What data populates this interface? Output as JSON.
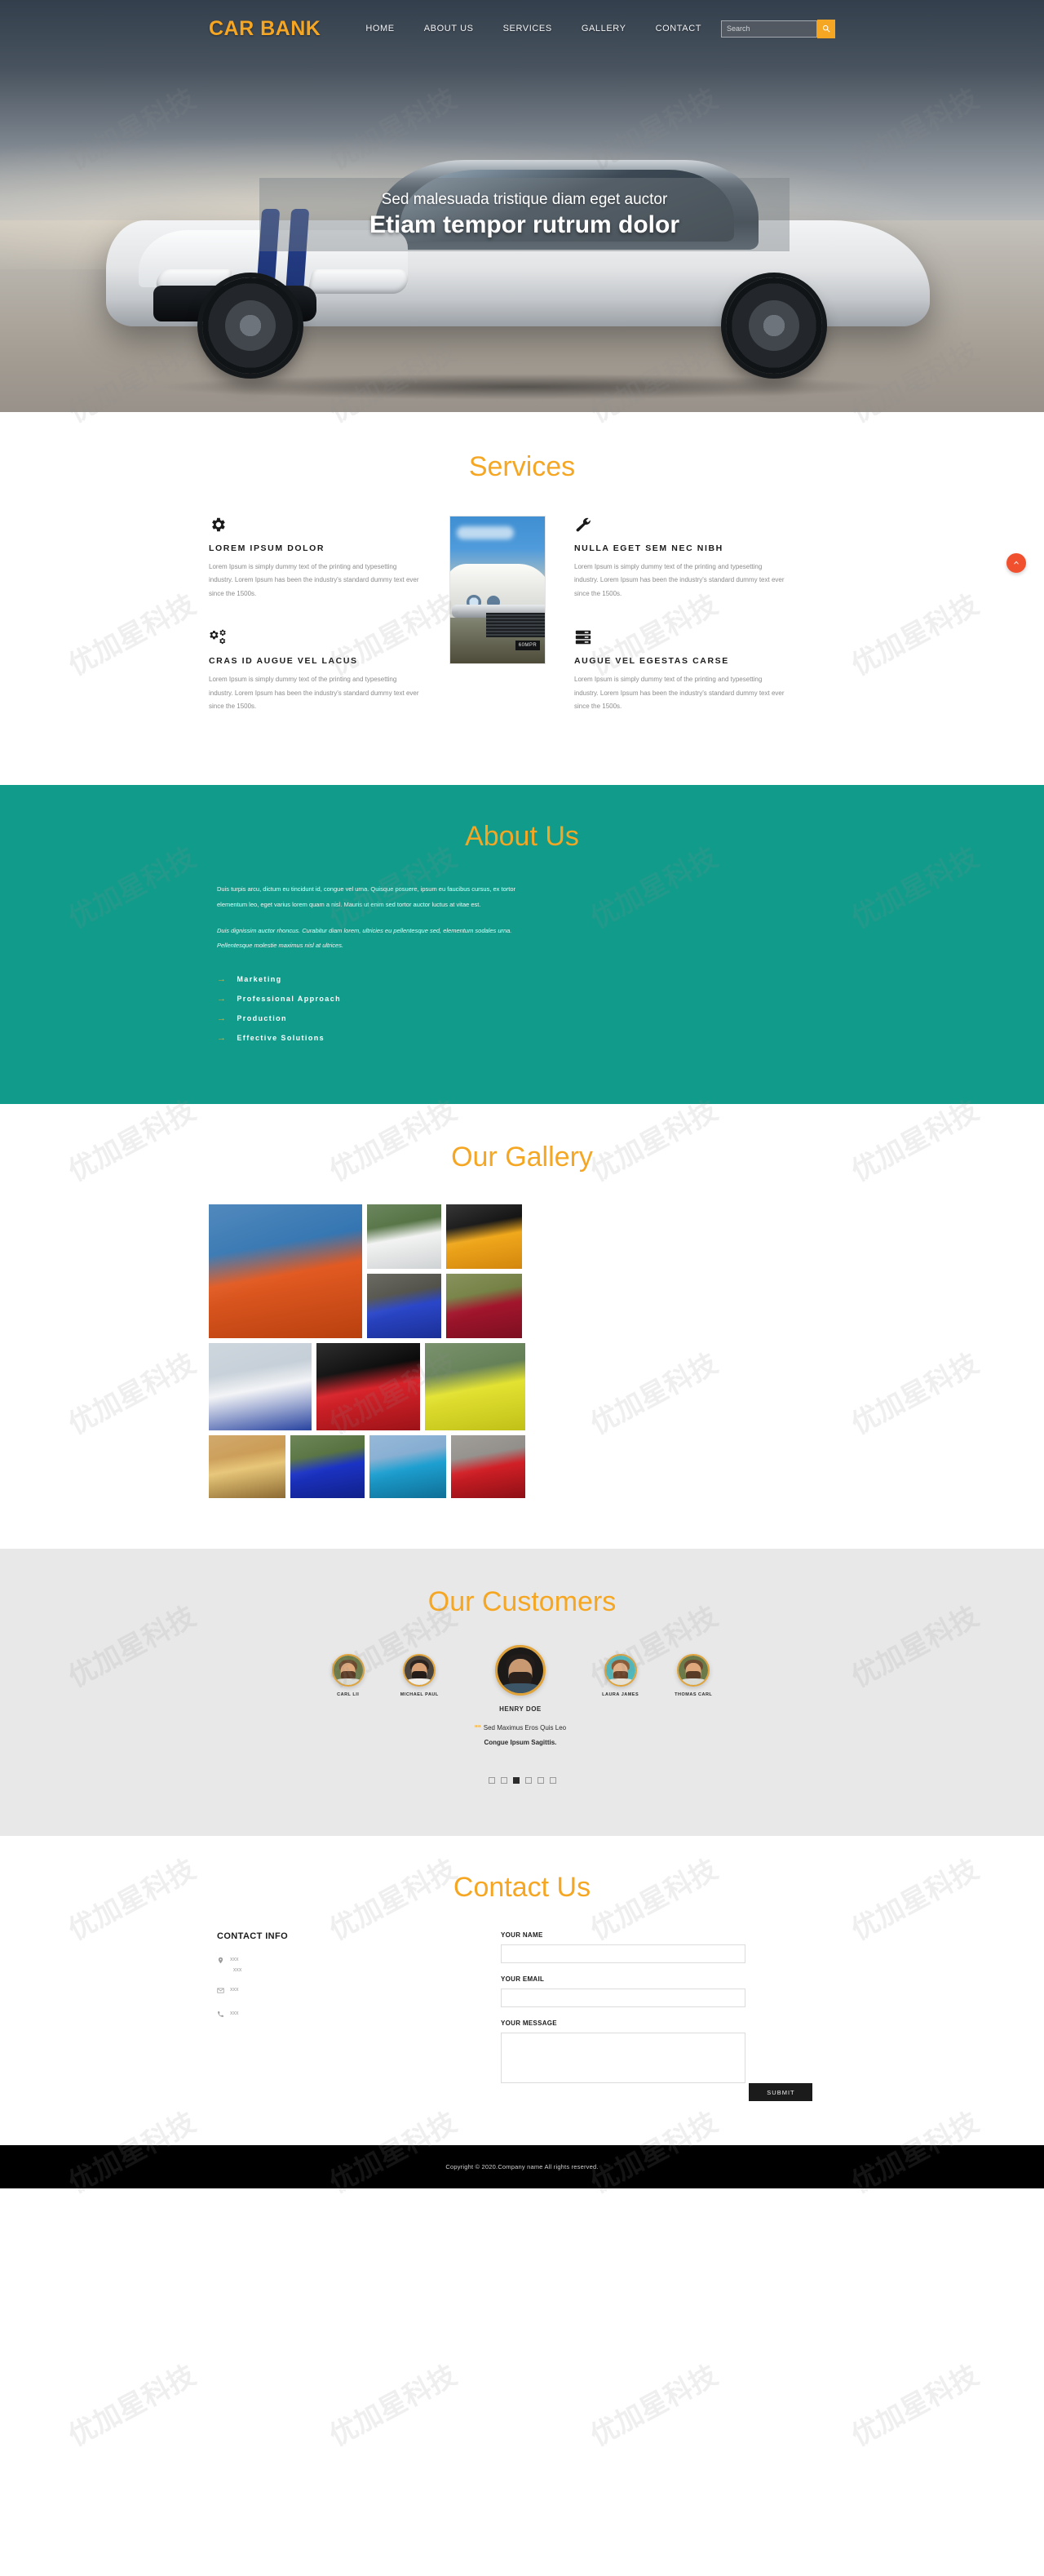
{
  "header": {
    "brand": "CAR BANK",
    "nav": [
      {
        "label": "HOME"
      },
      {
        "label": "ABOUT US"
      },
      {
        "label": "SERVICES"
      },
      {
        "label": "GALLERY"
      },
      {
        "label": "CONTACT"
      }
    ],
    "search": {
      "placeholder": "Search",
      "value": "",
      "icon": "search-icon"
    }
  },
  "hero": {
    "subtitle": "Sed malesuada tristique diam eget auctor",
    "title": "Etiam tempor rutrum dolor"
  },
  "services": {
    "title": "Services",
    "items": [
      {
        "icon": "gear-icon",
        "heading": "LOREM IPSUM DOLOR",
        "body": "Lorem Ipsum is simply dummy text of the printing and typesetting industry. Lorem Ipsum has been the industry's standard dummy text ever since the 1500s."
      },
      {
        "icon": "gears-icon",
        "heading": "CRAS ID AUGUE VEL LACUS",
        "body": "Lorem Ipsum is simply dummy text of the printing and typesetting industry. Lorem Ipsum has been the industry's standard dummy text ever since the 1500s."
      },
      {
        "icon": "wrench-icon",
        "heading": "NULLA EGET SEM NEC NIBH",
        "body": "Lorem Ipsum is simply dummy text of the printing and typesetting industry. Lorem Ipsum has been the industry's standard dummy text ever since the 1500s."
      },
      {
        "icon": "server-icon",
        "heading": "AUGUE VEL EGESTAS CARSE",
        "body": "Lorem Ipsum is simply dummy text of the printing and typesetting industry. Lorem Ipsum has been the industry's standard dummy text ever since the 1500s."
      }
    ],
    "photo_plate": "60MPR"
  },
  "about": {
    "title": "About Us",
    "paragraph1": "Duis turpis arcu, dictum eu tincidunt id, congue vel urna. Quisque posuere, ipsum eu faucibus cursus, ex tortor elementum leo, eget varius lorem quam a nisl. Mauris ut enim sed tortor auctor luctus at vitae est.",
    "paragraph2": "Duis dignissim auctor rhoncus. Curabitur diam lorem, ultricies eu pellentesque sed, elementum sodales urna. Pellentesque molestie maximus nisl at ultrices.",
    "list": [
      {
        "label": "Marketing"
      },
      {
        "label": "Professional Approach"
      },
      {
        "label": "Production"
      },
      {
        "label": "Effective Solutions"
      }
    ]
  },
  "gallery": {
    "title": "Our Gallery",
    "tiles": [
      {
        "name": "orange-bmw-front",
        "colors": [
          "#2b6fae",
          "#e25a22",
          "#b8400f"
        ]
      },
      {
        "name": "white-bmw-front",
        "colors": [
          "#4b6b3a",
          "#f2f3f2",
          "#cfd2d4"
        ]
      },
      {
        "name": "yellow-sportscar",
        "colors": [
          "#0a0a0a",
          "#f0a81c",
          "#d3860d"
        ]
      },
      {
        "name": "blue-audi-rear",
        "colors": [
          "#4a4a42",
          "#2b47c9",
          "#1b2f96"
        ]
      },
      {
        "name": "red-range-rover",
        "colors": [
          "#6d7a3a",
          "#a2152c",
          "#7d0f21"
        ]
      },
      {
        "name": "white-striped-mustang",
        "colors": [
          "#c3cdd6",
          "#f3f4f6",
          "#2743a0"
        ]
      },
      {
        "name": "red-audi-front",
        "colors": [
          "#000000",
          "#d8232a",
          "#9c1318"
        ]
      },
      {
        "name": "yellow-ford-focus",
        "colors": [
          "#5d7a4e",
          "#e3e232",
          "#c0c018"
        ]
      },
      {
        "name": "sunset-yellow-coupe",
        "colors": [
          "#c8974d",
          "#e7c678",
          "#8c6a33"
        ]
      },
      {
        "name": "blue-jaguar",
        "colors": [
          "#4e6b35",
          "#1b33c4",
          "#11208a"
        ]
      },
      {
        "name": "blue-classic-car",
        "colors": [
          "#7fa9cf",
          "#1d9fd0",
          "#0f6f96"
        ]
      },
      {
        "name": "red-ferrari",
        "colors": [
          "#8d8a85",
          "#d11f26",
          "#8e1016"
        ]
      }
    ]
  },
  "customers": {
    "title": "Our Customers",
    "people": [
      {
        "name": "CARL LII",
        "active": false,
        "hair": "#6b4a2f",
        "skin": "#dfa97c",
        "bg": "#6c7a4a"
      },
      {
        "name": "MICHAEL PAUL",
        "active": false,
        "hair": "#2a2320",
        "skin": "#d7a074",
        "bg": "#4a433c"
      },
      {
        "name": "HENRY DOE",
        "active": true,
        "hair": "#221d1b",
        "skin": "#c99a72",
        "bg": "#1c1a19"
      },
      {
        "name": "LAURA JAMES",
        "active": false,
        "hair": "#8a5b36",
        "skin": "#e0b089",
        "bg": "#4fb8bd"
      },
      {
        "name": "THOMAS CARL",
        "active": false,
        "hair": "#6b4a2f",
        "skin": "#dfa97c",
        "bg": "#6c7a4a"
      }
    ],
    "testimonial": {
      "name": "HENRY DOE",
      "line1": "Sed Maximus Eros Quis Leo",
      "line2": "Congue Ipsum Sagittis."
    },
    "dots": [
      {
        "active": false
      },
      {
        "active": false
      },
      {
        "active": true
      },
      {
        "active": false
      },
      {
        "active": false
      },
      {
        "active": false
      }
    ]
  },
  "contact": {
    "title": "Contact Us",
    "info_heading": "CONTACT INFO",
    "lines": [
      {
        "icon": "map-pin-icon",
        "value": "xxx",
        "value2": "xxx"
      },
      {
        "icon": "envelope-icon",
        "value": "xxx"
      },
      {
        "icon": "phone-icon",
        "value": "xxx"
      }
    ],
    "form": {
      "name_label": "YOUR NAME",
      "name_value": "",
      "email_label": "YOUR EMAIL",
      "email_value": "",
      "message_label": "YOUR MESSAGE",
      "message_value": "",
      "submit_label": "SUBMIT"
    }
  },
  "footer": {
    "copyright": "Copyright © 2020.Company name All rights reserved."
  },
  "scroll_top": {
    "icon": "chevron-up-icon"
  },
  "watermark": {
    "text": "优加星科技"
  }
}
